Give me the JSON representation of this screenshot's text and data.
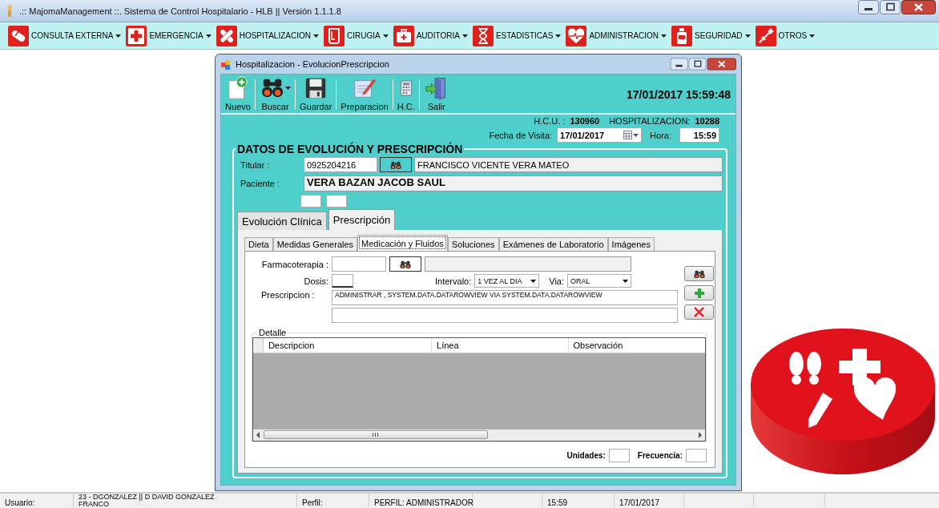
{
  "window": {
    "title": ".:: MajomaManagement ::. Sistema de Control Hospitalario - HLB || Versión 1.1.1.8"
  },
  "menu": [
    {
      "label": "CONSULTA EXTERNA",
      "kind": "pill"
    },
    {
      "label": "EMERGENCIA",
      "kind": "cross"
    },
    {
      "label": "HOSPITALIZACION",
      "kind": "bandage"
    },
    {
      "label": "CIRUGIA",
      "kind": "container"
    },
    {
      "label": "AUDITORIA",
      "kind": "kit"
    },
    {
      "label": "ESTADISTICAS",
      "kind": "hourglass"
    },
    {
      "label": "ADMINISTRACION",
      "kind": "heart"
    },
    {
      "label": "SEGURIDAD",
      "kind": "bottle"
    },
    {
      "label": "OTROS",
      "kind": "syringe"
    }
  ],
  "child_window": {
    "title": "Hospitalizacion - EvolucionPrescripcion",
    "toolbar": [
      {
        "label": "Nuevo",
        "kind": "new",
        "dropdown": false
      },
      {
        "label": "Buscar",
        "kind": "search",
        "dropdown": true
      },
      {
        "label": "Guardar",
        "kind": "save",
        "dropdown": false
      },
      {
        "label": "Preparacion",
        "kind": "edit",
        "dropdown": false
      },
      {
        "label": "H.C.",
        "kind": "record",
        "dropdown": false
      },
      {
        "label": "Salir",
        "kind": "exit",
        "dropdown": false
      }
    ],
    "datetime": "17/01/2017  15:59:48",
    "hcu_label": "H.C.U. :",
    "hcu": "130960",
    "hosp_label": "HOSPITALIZACION:",
    "hosp": "10288",
    "visit_label": "Fecha de Visita:",
    "visit_date": "17/01/2017",
    "hora_label": "Hora:",
    "hora": "15:59",
    "group_title": "DATOS DE EVOLUCIÓN Y PRESCRIPCIÓN",
    "titular_label": "Titular :",
    "titular_id": "0925204216",
    "titular_name": "FRANCISCO VICENTE VERA MATEO",
    "paciente_label": "Paciente :",
    "paciente": "VERA BAZAN JACOB SAUL",
    "outer_tabs": [
      {
        "label": "Evolución Clínica",
        "selected": false
      },
      {
        "label": "Prescripción",
        "selected": true
      }
    ],
    "inner_tabs": [
      {
        "label": "Dieta",
        "selected": false
      },
      {
        "label": "Medidas Generales",
        "selected": false
      },
      {
        "label": "Medicación y Fluidos",
        "selected": true
      },
      {
        "label": "Soluciones",
        "selected": false
      },
      {
        "label": "Exámenes de Laboratorio",
        "selected": false
      },
      {
        "label": "Imágenes",
        "selected": false
      }
    ],
    "form": {
      "farmaco_label": "Farmacoterapia :",
      "dosis_label": "Dosis:",
      "intervalo_label": "Intervalo:",
      "intervalo": "1 VEZ AL DIA",
      "via_label": "Via:",
      "via": "ORAL",
      "prescripcion_label": "Prescripcion :",
      "prescripcion": "ADMINISTRAR  , SYSTEM.DATA.DATAROWVIEW VIA SYSTEM.DATA.DATAROWVIEW"
    },
    "detalle": {
      "title": "Detalle",
      "columns": [
        "Descripcion",
        "Línea",
        "Observación"
      ]
    },
    "unidades_label": "Unidades:",
    "frecuencia_label": "Frecuencia:"
  },
  "status_bar": {
    "user_label": "Usuario:",
    "user": "23 - DGONZALEZ || D DAVID GONZALEZ FRANCO",
    "profile_label": "Perfil:",
    "profile": "PERFIL: ADMINISTRADOR",
    "time": "15:59",
    "date": "17/01/2017"
  }
}
